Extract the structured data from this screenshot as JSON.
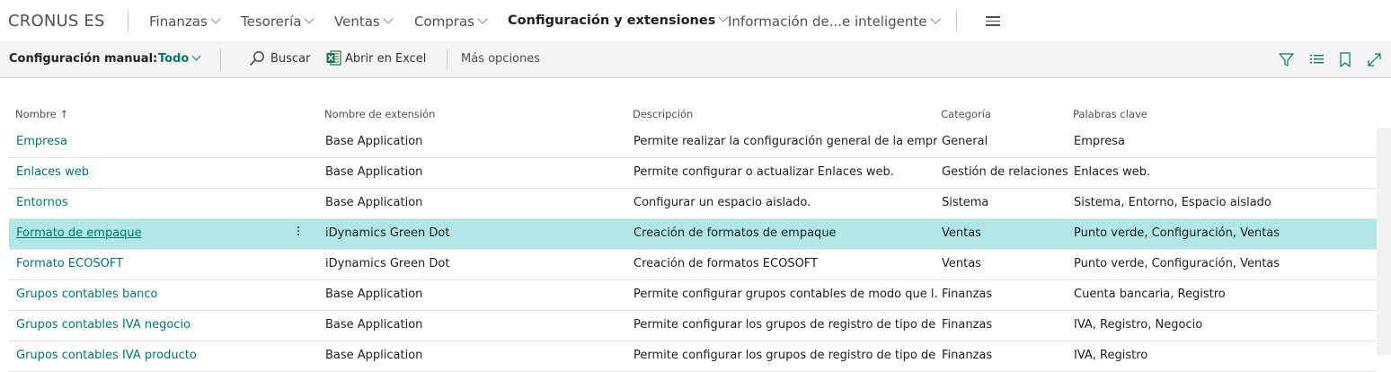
{
  "topnav": {
    "company": "CRONUS ES",
    "items": [
      {
        "label": "Finanzas"
      },
      {
        "label": "Tesorería"
      },
      {
        "label": "Ventas"
      },
      {
        "label": "Compras"
      },
      {
        "label": "Configuración y extensiones"
      },
      {
        "label": "Información de...e inteligente"
      }
    ],
    "active_index": 4
  },
  "actionbar": {
    "title": "Configuración manual:",
    "view": "Todo",
    "search_label": "Buscar",
    "excel_label": "Abrir en Excel",
    "more_label": "Más opciones"
  },
  "table": {
    "columns": [
      "Nombre",
      "Nombre de extensión",
      "Descripción",
      "Categoría",
      "Palabras clave"
    ],
    "sort_indicator": "↑",
    "rows": [
      {
        "name": "Empresa",
        "extension": "Base Application",
        "description": "Permite realizar la configuración general de la empre...",
        "category": "General",
        "keywords": "Empresa"
      },
      {
        "name": "Enlaces web",
        "extension": "Base Application",
        "description": "Permite configurar o actualizar Enlaces web.",
        "category": "Gestión de relaciones",
        "keywords": "Enlaces web."
      },
      {
        "name": "Entornos",
        "extension": "Base Application",
        "description": "Configurar un espacio aislado.",
        "category": "Sistema",
        "keywords": "Sistema, Entorno, Espacio aislado"
      },
      {
        "name": "Formato de empaque",
        "extension": "iDynamics Green Dot",
        "description": "Creación de formatos de empaque",
        "category": "Ventas",
        "keywords": "Punto verde, Configuración, Ventas"
      },
      {
        "name": "Formato ECOSOFT",
        "extension": "iDynamics Green Dot",
        "description": "Creación de formatos ECOSOFT",
        "category": "Ventas",
        "keywords": "Punto verde, Configuración, Ventas"
      },
      {
        "name": "Grupos contables banco",
        "extension": "Base Application",
        "description": "Permite configurar grupos contables de modo que l...",
        "category": "Finanzas",
        "keywords": "Cuenta bancaria, Registro"
      },
      {
        "name": "Grupos contables IVA negocio",
        "extension": "Base Application",
        "description": "Permite configurar los grupos de registro de tipo de ...",
        "category": "Finanzas",
        "keywords": "IVA, Registro, Negocio"
      },
      {
        "name": "Grupos contables IVA producto",
        "extension": "Base Application",
        "description": "Permite configurar los grupos de registro de tipo de ...",
        "category": "Finanzas",
        "keywords": "IVA, Registro"
      }
    ],
    "selected_index": 3
  },
  "colors": {
    "accent": "#00796b",
    "selected_row": "#b2e7e8"
  }
}
